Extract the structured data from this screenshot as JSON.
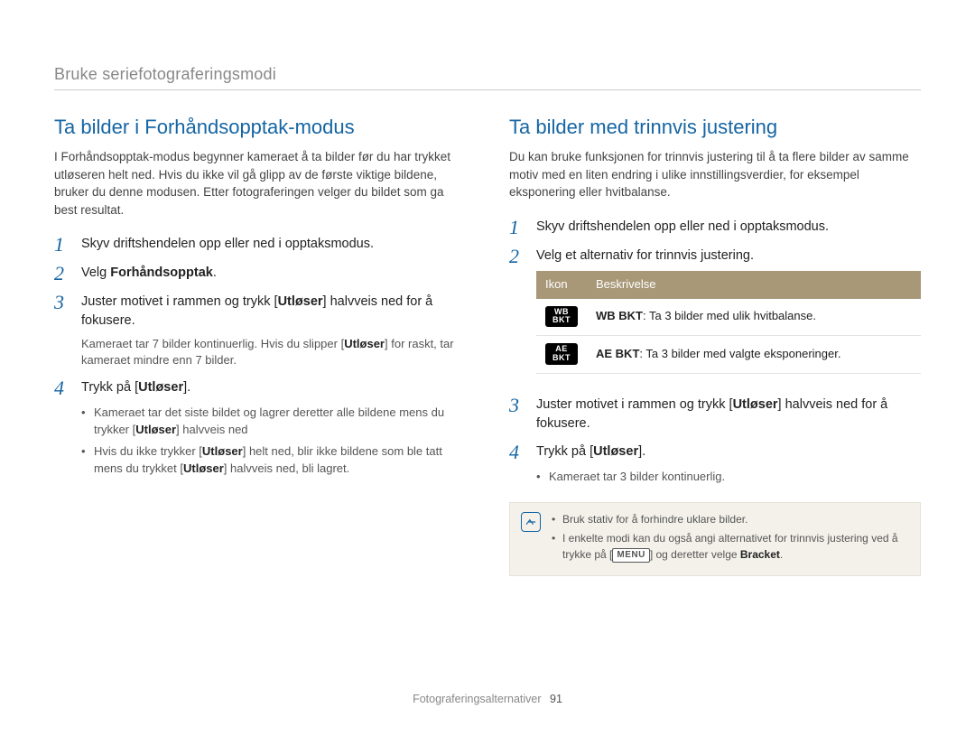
{
  "breadcrumb": "Bruke seriefotograferingsmodi",
  "left": {
    "title": "Ta bilder i Forhåndsopptak-modus",
    "intro": "I Forhåndsopptak-modus begynner kameraet å ta bilder før du har trykket utløseren helt ned. Hvis du ikke vil gå glipp av de første viktige bildene, bruker du denne modusen. Etter fotograferingen velger du bildet som ga best resultat.",
    "steps": {
      "s1": "Skyv driftshendelen opp eller ned i opptaksmodus.",
      "s2_pre": "Velg ",
      "s2_bold": "Forhåndsopptak",
      "s2_post": ".",
      "s3_a": "Juster motivet i rammen og trykk [",
      "s3_b": "Utløser",
      "s3_c": "] halvveis ned for å fokusere.",
      "s3_sub_a": "Kameraet tar 7 bilder kontinuerlig. Hvis du slipper [",
      "s3_sub_b": "Utløser",
      "s3_sub_c": "] for raskt, tar kameraet mindre enn 7 bilder.",
      "s4_a": "Trykk på [",
      "s4_b": "Utløser",
      "s4_c": "].",
      "s4_li1_a": "Kameraet tar det siste bildet og lagrer deretter alle bildene mens du trykker [",
      "s4_li1_b": "Utløser",
      "s4_li1_c": "] halvveis ned",
      "s4_li2_a": "Hvis du ikke trykker [",
      "s4_li2_b": "Utløser",
      "s4_li2_c": "] helt ned, blir ikke bildene som ble tatt mens du trykket [",
      "s4_li2_d": "Utløser",
      "s4_li2_e": "] halvveis ned, bli lagret."
    }
  },
  "right": {
    "title": "Ta bilder med trinnvis justering",
    "intro": "Du kan bruke funksjonen for trinnvis justering til å ta flere bilder av samme motiv med en liten endring i ulike innstillingsverdier, for eksempel eksponering eller hvitbalanse.",
    "steps": {
      "s1": "Skyv driftshendelen opp eller ned i opptaksmodus.",
      "s2": "Velg et alternativ for trinnvis justering.",
      "s3_a": "Juster motivet i rammen og trykk [",
      "s3_b": "Utløser",
      "s3_c": "] halvveis ned for å fokusere.",
      "s4_a": "Trykk på [",
      "s4_b": "Utløser",
      "s4_c": "].",
      "s4_li1": "Kameraet tar 3 bilder kontinuerlig."
    },
    "table": {
      "h1": "Ikon",
      "h2": "Beskrivelse",
      "r1_icon": "WB BKT",
      "r1_b": "WB BKT",
      "r1_t": ": Ta 3 bilder med ulik hvitbalanse.",
      "r2_icon": "AE BKT",
      "r2_b": "AE BKT",
      "r2_t": ": Ta 3 bilder med valgte eksponeringer."
    },
    "note": {
      "li1": "Bruk stativ for å forhindre uklare bilder.",
      "li2_a": "I enkelte modi kan du også angi alternativet for trinnvis justering ved å trykke på [",
      "li2_menu": "MENU",
      "li2_b": "] og deretter velge ",
      "li2_bold": "Bracket",
      "li2_c": "."
    }
  },
  "footer": {
    "label": "Fotograferingsalternativer",
    "page": "91"
  },
  "nums": {
    "n1": "1",
    "n2": "2",
    "n3": "3",
    "n4": "4"
  }
}
